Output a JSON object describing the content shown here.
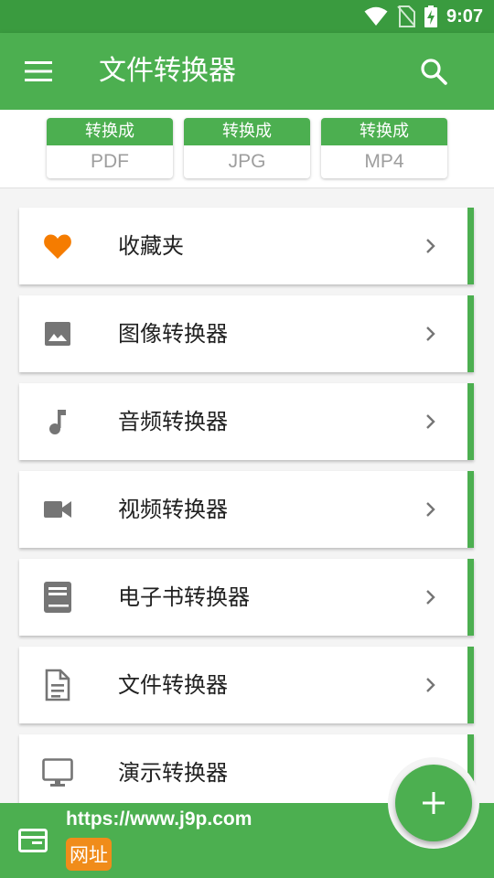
{
  "status_bar": {
    "time": "9:07",
    "icons": [
      "wifi-icon",
      "no-sim-icon",
      "battery-charging-icon"
    ]
  },
  "app_bar": {
    "title": "文件转换器",
    "menu_icon": "hamburger-menu-icon",
    "search_icon": "search-icon"
  },
  "quick_convert": [
    {
      "header": "转换成",
      "format": "PDF"
    },
    {
      "header": "转换成",
      "format": "JPG"
    },
    {
      "header": "转换成",
      "format": "MP4"
    }
  ],
  "menu": {
    "items": [
      {
        "label": "收藏夹",
        "icon": "heart-icon"
      },
      {
        "label": "图像转换器",
        "icon": "image-icon"
      },
      {
        "label": "音频转换器",
        "icon": "music-note-icon"
      },
      {
        "label": "视频转换器",
        "icon": "video-camera-icon"
      },
      {
        "label": "电子书转换器",
        "icon": "book-icon"
      },
      {
        "label": "文件转换器",
        "icon": "document-icon"
      },
      {
        "label": "演示转换器",
        "icon": "monitor-icon"
      }
    ]
  },
  "banner": {
    "url": "https://www.j9p.com",
    "badge": "网址",
    "icon": "browser-window-icon"
  },
  "fab": {
    "icon": "plus-icon"
  },
  "colors": {
    "primary": "#4caf50",
    "primary_dark": "#3a9b3f",
    "favorite": "#f57c00",
    "badge": "#f08c1a"
  }
}
